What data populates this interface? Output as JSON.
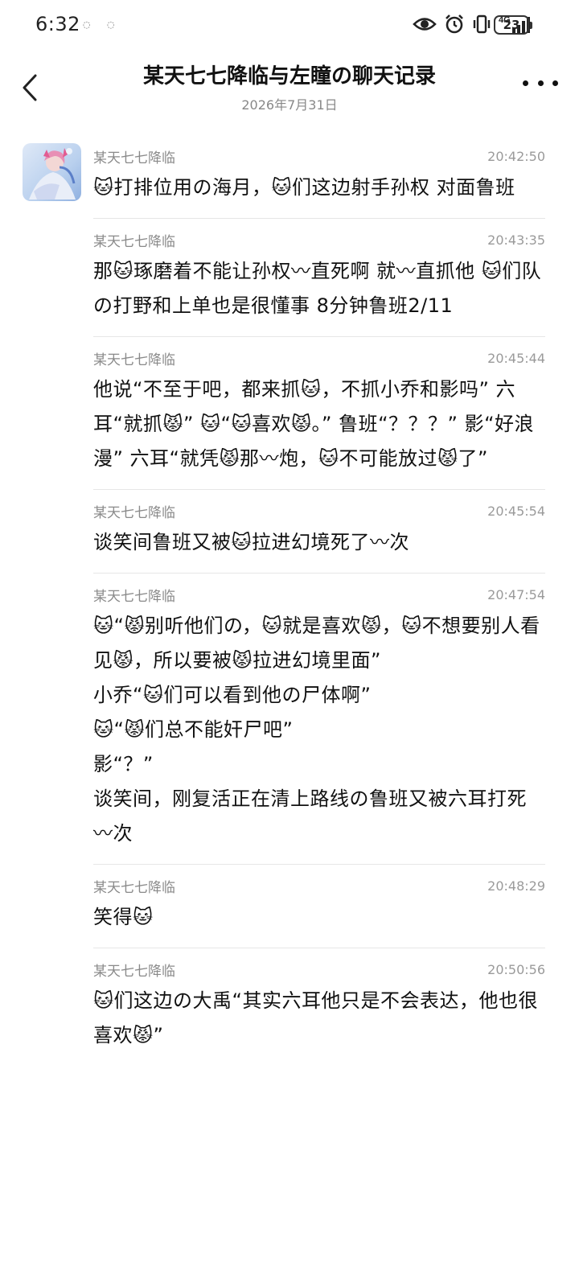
{
  "status_bar": {
    "time": "6:32",
    "network_label": "4G",
    "battery_level": "23"
  },
  "header": {
    "title": "某天七七降临与左瞳の聊天记录",
    "date": "2026年7月31日"
  },
  "messages": [
    {
      "sender": "某天七七降临",
      "time": "20:42:50",
      "text": "🐱打排位用の海月，🐱们这边射手孙权 对面鲁班"
    },
    {
      "sender": "某天七七降临",
      "time": "20:43:35",
      "text": "那🐱琢磨着不能让孙权〰直死啊 就〰直抓他 🐱们队の打野和上单也是很懂事 8分钟鲁班2/11"
    },
    {
      "sender": "某天七七降临",
      "time": "20:45:44",
      "text": "他说“不至于吧，都来抓🐱，不抓小乔和影吗” 六耳“就抓😾” 🐱“🐱喜欢😾。” 鲁班“？？？” 影“好浪漫” 六耳“就凭😾那〰炮，🐱不可能放过😾了”"
    },
    {
      "sender": "某天七七降临",
      "time": "20:45:54",
      "text": "谈笑间鲁班又被🐱拉进幻境死了〰次"
    },
    {
      "sender": "某天七七降临",
      "time": "20:47:54",
      "text": "🐱“😾别听他们の，🐱就是喜欢😾，🐱不想要别人看见😾，所以要被😾拉进幻境里面”\n小乔“🐱们可以看到他の尸体啊”\n🐱“😾们总不能奸尸吧”\n影“？”\n谈笑间，刚复活正在清上路线の鲁班又被六耳打死〰次"
    },
    {
      "sender": "某天七七降临",
      "time": "20:48:29",
      "text": "笑得🐱"
    },
    {
      "sender": "某天七七降临",
      "time": "20:50:56",
      "text": "🐱们这边の大禹“其实六耳他只是不会表达，他也很喜欢😾”"
    }
  ]
}
